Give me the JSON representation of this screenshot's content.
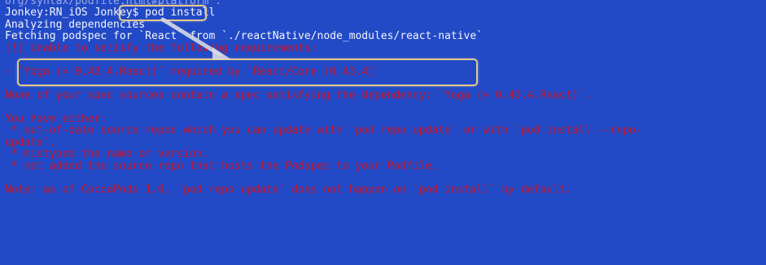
{
  "terminal": {
    "lines": [
      {
        "text": "org/syntax/podfile.html#platform`.",
        "color": "white"
      },
      {
        "text": "Jonkey:RN_iOS Jonkey$ pod install",
        "color": "white"
      },
      {
        "text": "Analyzing dependencies",
        "color": "white"
      },
      {
        "text": "Fetching podspec for `React` from `./reactNative/node_modules/react-native`",
        "color": "white"
      },
      {
        "text": "[!] Unable to satisfy the following requirements:",
        "color": "red"
      },
      {
        "text": "",
        "color": "red"
      },
      {
        "text": "- `Yoga (= 0.43.4.React)` required by `React/Core (0.43.4)`",
        "color": "red"
      },
      {
        "text": "",
        "color": "red"
      },
      {
        "text": "None of your spec sources contain a spec satisfying the dependency: `Yoga (= 0.43.4.React)`.",
        "color": "red"
      },
      {
        "text": "",
        "color": "red"
      },
      {
        "text": "You have either:",
        "color": "red"
      },
      {
        "text": " * out-of-date source repos which you can update with `pod repo update` or with `pod install --repo-",
        "color": "red"
      },
      {
        "text": "update`.",
        "color": "red"
      },
      {
        "text": " * mistyped the name or version.",
        "color": "red"
      },
      {
        "text": " * not added the source repo that hosts the Podspec to your Podfile.",
        "color": "red"
      },
      {
        "text": "",
        "color": "red"
      },
      {
        "text": "Note: as of CocoaPods 1.0, `pod repo update` does not happen on `pod install` by default.",
        "color": "red"
      }
    ]
  },
  "colors": {
    "background": "#2249c6",
    "output_text": "#f3f5fb",
    "error_text": "#c8162b",
    "annotation": "#e8c98c"
  }
}
